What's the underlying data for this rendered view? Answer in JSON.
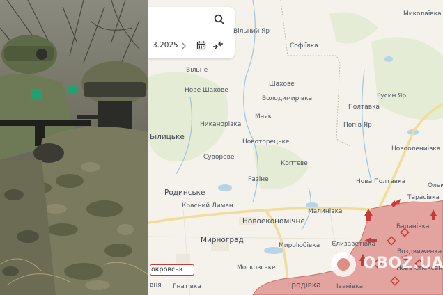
{
  "map": {
    "date_fragment": "3.2025",
    "places": [
      {
        "name": "Миколаївка"
      },
      {
        "name": "Вільний Яр"
      },
      {
        "name": "Софіївка"
      },
      {
        "name": "Вільне"
      },
      {
        "name": "Шахове"
      },
      {
        "name": "Нове Шахове"
      },
      {
        "name": "Володимирівка"
      },
      {
        "name": "Русин Яр"
      },
      {
        "name": "Полтавка"
      },
      {
        "name": "Никанорівка"
      },
      {
        "name": "Маяк"
      },
      {
        "name": "Попів Яр"
      },
      {
        "name": "Білицьке"
      },
      {
        "name": "Новоторецьке"
      },
      {
        "name": "Новоолениівка"
      },
      {
        "name": "Суворове"
      },
      {
        "name": "Коптєве"
      },
      {
        "name": "Разіне"
      },
      {
        "name": "Нова Полтавка"
      },
      {
        "name": "Олек"
      },
      {
        "name": "Родинське"
      },
      {
        "name": "Тарасівка"
      },
      {
        "name": "Красний Лиман"
      },
      {
        "name": "Малинівка"
      },
      {
        "name": "Новоекономічне"
      },
      {
        "name": "Баранівка"
      },
      {
        "name": "Мирноград"
      },
      {
        "name": "Єлизаветівка"
      },
      {
        "name": "Мирolюбівка"
      },
      {
        "name": "Воздвиженка"
      },
      {
        "name": "Московське"
      },
      {
        "name": "Нова Олександ"
      },
      {
        "name": "Гродівка"
      },
      {
        "name": "Гнатівка"
      },
      {
        "name": "Іванівка"
      },
      {
        "name": "вня"
      },
      {
        "name": "Покровськ"
      }
    ],
    "highlighted_city": "окровськ",
    "watermark": "OBOZ.UA"
  }
}
